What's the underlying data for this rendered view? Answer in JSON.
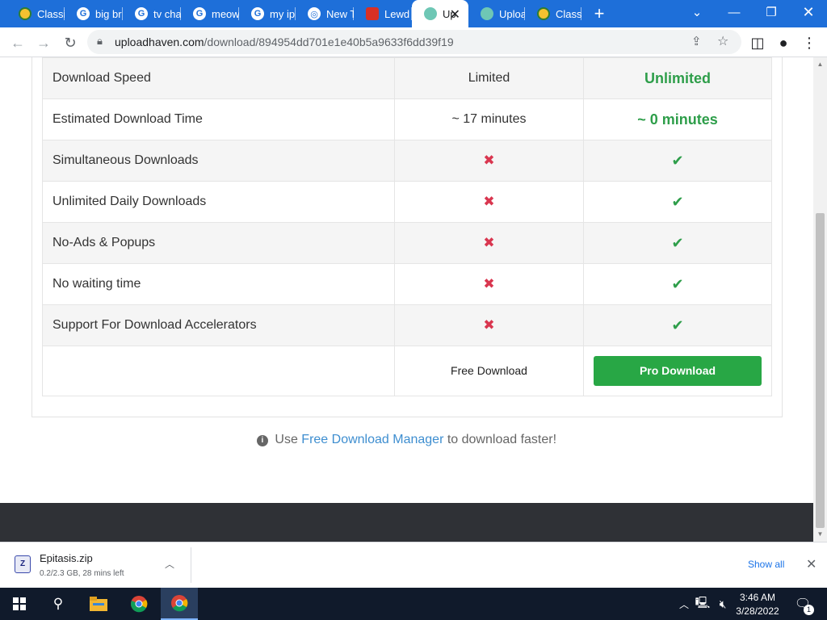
{
  "browser": {
    "tabs": [
      {
        "label": "Classi",
        "icon": "classy-icon",
        "active": false
      },
      {
        "label": "big br",
        "icon": "google-icon",
        "active": false
      },
      {
        "label": "tv cha",
        "icon": "google-icon",
        "active": false
      },
      {
        "label": "meow",
        "icon": "google-icon",
        "active": false
      },
      {
        "label": "my ip",
        "icon": "google-icon",
        "active": false
      },
      {
        "label": "New T",
        "icon": "chrome-icon",
        "active": false
      },
      {
        "label": "Lewd",
        "icon": "lewd-icon",
        "active": false
      },
      {
        "label": "Up",
        "icon": "cloud-icon",
        "active": true
      },
      {
        "label": "Uploa",
        "icon": "cloud-icon",
        "active": false
      },
      {
        "label": "Classi",
        "icon": "classy-icon",
        "active": false
      }
    ],
    "new_tab_symbol": "+",
    "url_domain": "uploadhaven.com",
    "url_path": "/download/894954dd701e1e40b5a9633f6dd39f19"
  },
  "comparison": {
    "rows": [
      {
        "feature": "Download Speed",
        "free": "Limited",
        "pro": "Unlimited",
        "type": "text"
      },
      {
        "feature": "Estimated Download Time",
        "free": "~ 17 minutes",
        "pro": "~ 0 minutes",
        "type": "text"
      },
      {
        "feature": "Simultaneous Downloads",
        "free": "✖",
        "pro": "✔",
        "type": "icon"
      },
      {
        "feature": "Unlimited Daily Downloads",
        "free": "✖",
        "pro": "✔",
        "type": "icon"
      },
      {
        "feature": "No-Ads & Popups",
        "free": "✖",
        "pro": "✔",
        "type": "icon"
      },
      {
        "feature": "No waiting time",
        "free": "✖",
        "pro": "✔",
        "type": "icon"
      },
      {
        "feature": "Support For Download Accelerators",
        "free": "✖",
        "pro": "✔",
        "type": "icon"
      }
    ],
    "free_download_label": "Free Download",
    "pro_download_label": "Pro Download"
  },
  "tip": {
    "prefix": "Use",
    "link": "Free Download Manager",
    "suffix": "to download faster!"
  },
  "download_shelf": {
    "file_name": "Epitasis.zip",
    "status": "0.2/2.3 GB, 28 mins left",
    "show_all": "Show all"
  },
  "taskbar": {
    "time": "3:46 AM",
    "date": "3/28/2022",
    "notification_count": "1"
  },
  "colors": {
    "tabstrip": "#1e6fd9",
    "pro_green": "#2e9e4a",
    "button_green": "#28a745",
    "cross_red": "#d9364f",
    "link_blue": "#3e8ed0"
  }
}
